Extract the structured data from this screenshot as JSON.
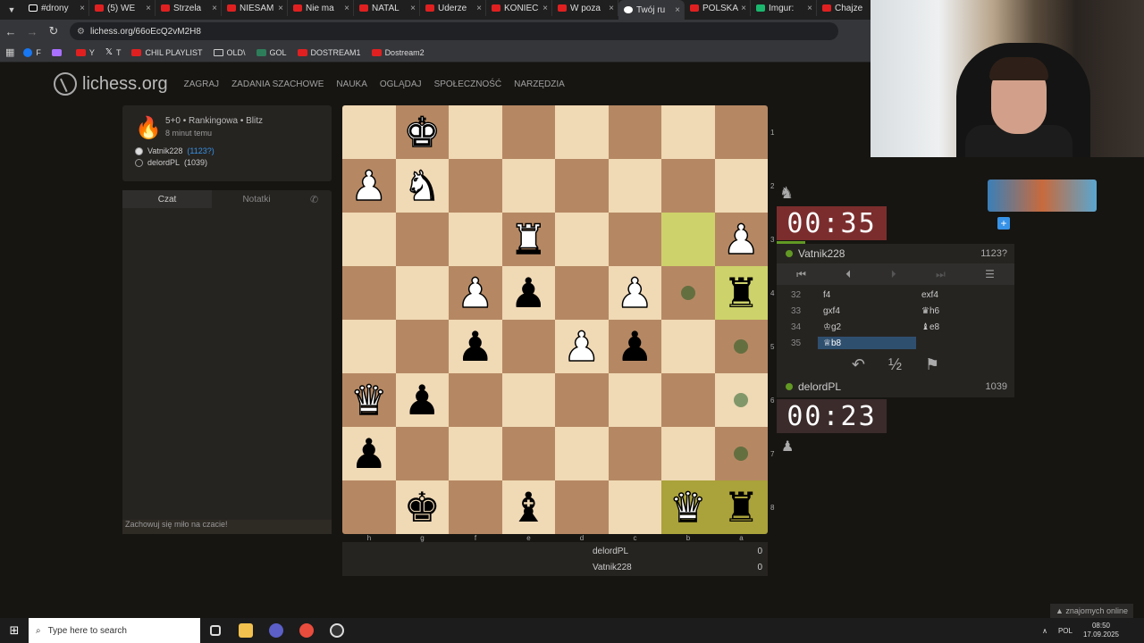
{
  "tabs": [
    {
      "label": "#drony",
      "type": "tk"
    },
    {
      "label": "(5) WE",
      "type": "yt"
    },
    {
      "label": "Strzela",
      "type": "yt"
    },
    {
      "label": "NIESAM",
      "type": "yt"
    },
    {
      "label": "Nie ma",
      "type": "yt"
    },
    {
      "label": "NATAL",
      "type": "yt"
    },
    {
      "label": "Uderze",
      "type": "yt"
    },
    {
      "label": "KONIEC",
      "type": "yt"
    },
    {
      "label": "W poza",
      "type": "yt"
    },
    {
      "label": "Twój ru",
      "type": "li"
    },
    {
      "label": "POLSKA",
      "type": "yt"
    },
    {
      "label": "Imgur:",
      "type": "im"
    },
    {
      "label": "Chajze",
      "type": "yt"
    }
  ],
  "url": "lichess.org/66oEcQ2vM2H8",
  "bookmarks": [
    {
      "label": "F",
      "icon": "fb"
    },
    {
      "label": "",
      "icon": "tw"
    },
    {
      "label": "Y",
      "icon": "yt"
    },
    {
      "label": "T",
      "icon": "xx"
    },
    {
      "label": "CHIL PLAYLIST",
      "icon": "yt"
    },
    {
      "label": "OLD\\",
      "icon": "folder"
    },
    {
      "label": "GOL",
      "icon": "gol"
    },
    {
      "label": "DOSTREAM1",
      "icon": "yt"
    },
    {
      "label": "Dostream2",
      "icon": "yt"
    }
  ],
  "logo": "lichess.org",
  "nav": [
    "ZAGRAJ",
    "ZADANIA SZACHOWE",
    "NAUKA",
    "OGLĄDAJ",
    "SPOŁECZNOŚĆ",
    "NARZĘDZIA"
  ],
  "game": {
    "title": "5+0 • Rankingowa • Blitz",
    "time_ago": "8 minut temu",
    "white": {
      "name": "Vatnik228",
      "rating": "(1123?)"
    },
    "black": {
      "name": "delordPL",
      "rating": "(1039)"
    }
  },
  "chat": {
    "tab1": "Czat",
    "tab2": "Notatki",
    "placeholder": "Zachowuj się miło na czacie!"
  },
  "board": {
    "ranks": [
      "1",
      "2",
      "3",
      "4",
      "5",
      "6",
      "7",
      "8"
    ],
    "files": [
      "h",
      "g",
      "f",
      "e",
      "d",
      "c",
      "b",
      "a"
    ],
    "pieces": [
      {
        "sq": "g1",
        "p": "♚",
        "c": "white"
      },
      {
        "sq": "h2",
        "p": "♟",
        "c": "white"
      },
      {
        "sq": "g2",
        "p": "♞",
        "c": "white"
      },
      {
        "sq": "e3",
        "p": "♜",
        "c": "white"
      },
      {
        "sq": "a3",
        "p": "♟",
        "c": "white"
      },
      {
        "sq": "f4",
        "p": "♟",
        "c": "white"
      },
      {
        "sq": "e4",
        "p": "♟",
        "c": "black"
      },
      {
        "sq": "c4",
        "p": "♟",
        "c": "white"
      },
      {
        "sq": "a4",
        "p": "♜",
        "c": "black"
      },
      {
        "sq": "f5",
        "p": "♟",
        "c": "black"
      },
      {
        "sq": "d5",
        "p": "♟",
        "c": "white"
      },
      {
        "sq": "c5",
        "p": "♟",
        "c": "black"
      },
      {
        "sq": "h6",
        "p": "♛",
        "c": "white"
      },
      {
        "sq": "g6",
        "p": "♟",
        "c": "black"
      },
      {
        "sq": "h7",
        "p": "♟",
        "c": "black"
      },
      {
        "sq": "g8",
        "p": "♚",
        "c": "black"
      },
      {
        "sq": "e8",
        "p": "♝",
        "c": "black"
      },
      {
        "sq": "b8",
        "p": "♛",
        "c": "white"
      },
      {
        "sq": "a8",
        "p": "♜",
        "c": "black"
      }
    ],
    "highlight_light": [
      "b3"
    ],
    "highlight_dark": [
      "b8",
      "a8"
    ],
    "highlight_check": [
      "a4"
    ],
    "move_dots": [
      "b4",
      "a5",
      "a6",
      "a7"
    ]
  },
  "clocks": {
    "top": {
      "min": "00",
      "sec": "35"
    },
    "bottom": {
      "min": "00",
      "sec": "23"
    }
  },
  "players": {
    "top": {
      "name": "Vatnik228",
      "rating": "1123?"
    },
    "bottom": {
      "name": "delordPL",
      "rating": "1039"
    }
  },
  "moves": [
    {
      "n": "32",
      "w": "f4",
      "b": "exf4"
    },
    {
      "n": "33",
      "w": "gxf4",
      "b": "♛h6"
    },
    {
      "n": "34",
      "w": "♔g2",
      "b": "♝e8"
    },
    {
      "n": "35",
      "w": "♕b8",
      "b": ""
    }
  ],
  "score": [
    {
      "name": "delordPL",
      "pts": "0"
    },
    {
      "name": "Vatnik228",
      "pts": "0"
    }
  ],
  "friends": "znajomych online",
  "taskbar": {
    "search": "Type here to search",
    "lang": "POL",
    "time": "08:50",
    "date": "17.09.2025"
  },
  "colors": {
    "accent": "#3692e7",
    "light_square": "#f0d9b5",
    "dark_square": "#b58863",
    "online": "#629924"
  }
}
